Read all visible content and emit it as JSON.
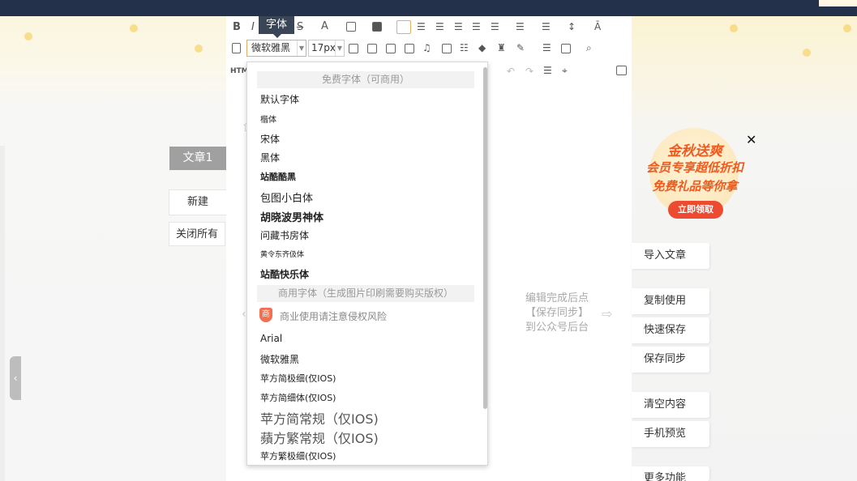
{
  "toolbar": {
    "tooltip": "字体",
    "font_value": "微软雅黑",
    "size_value": "17px",
    "bold": "B",
    "italic": "I",
    "strike": "S",
    "color": "A",
    "html_label": "HTM"
  },
  "sidebar": {
    "doc_tab": "文章1",
    "new_label": "新建",
    "close_all_label": "关闭所有"
  },
  "font_menu": {
    "free_header": "免费字体（可商用）",
    "free_fonts": [
      "默认字体",
      "楷体",
      "宋体",
      "黑体",
      "站酷酷黑",
      "包图小白体",
      "胡晓波男神体",
      "问藏书房体",
      "黄令东齐伋体",
      "站酷快乐体"
    ],
    "commercial_header": "商用字体（生成图片印刷需要购买版权）",
    "warning": "商业使用请注意侵权风险",
    "warning_icon": "商",
    "commercial_fonts": [
      "Arial",
      "微软雅黑",
      "苹方简极细(仅IOS)",
      "苹方简细体(仅IOS)",
      "苹方简常规（仅IOS)",
      "蘋方繁常规（仅IOS)",
      "苹方繁极细(仅IOS)"
    ]
  },
  "hint": {
    "line1": "编辑完成后点",
    "line2": "【保存同步】",
    "line3": "到公众号后台"
  },
  "promo": {
    "line1": "金秋送爽",
    "line2": "会员专享超低折扣",
    "line3": "免费礼品等你拿",
    "button": "立即领取"
  },
  "right_actions": [
    "导入文章",
    "复制使用",
    "快速保存",
    "保存同步",
    "清空内容",
    "手机预览",
    "更多功能"
  ],
  "colors": {
    "topbar": "#23324a",
    "accent": "#ef5a1f",
    "promo_button": "#ec4b32"
  }
}
